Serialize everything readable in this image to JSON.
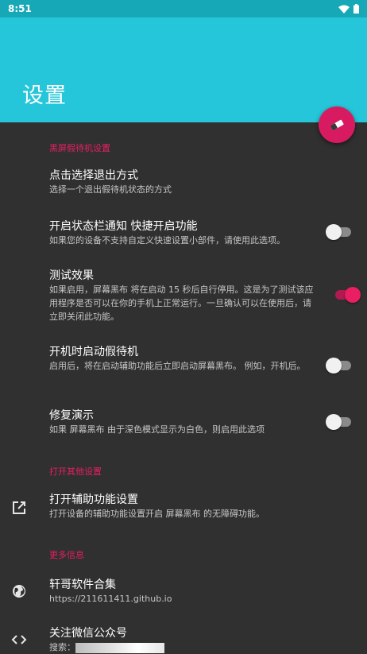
{
  "status_bar": {
    "time": "8:51",
    "wifi_icon": "wifi-icon",
    "battery_icon": "battery-icon"
  },
  "app_bar": {
    "title": "设置",
    "fab_icon": "eraser-icon"
  },
  "sections": {
    "standby": {
      "header": "黑屏假待机设置",
      "items": [
        {
          "title": "点击选择退出方式",
          "summary": "选择一个退出假待机状态的方式"
        },
        {
          "title": "开启状态栏通知 快捷开启功能",
          "summary": "如果您的设备不支持自定义快速设置小部件，请使用此选项。",
          "toggle": false
        },
        {
          "title": "测试效果",
          "summary": "如果启用，屏幕黑布 将在启动 15 秒后自行停用。这是为了测试该应用程序是否可以在你的手机上正常运行。一旦确认可以在使用后，请立即关闭此功能。",
          "toggle": true
        },
        {
          "title": "开机时启动假待机",
          "summary": "启用后，将在启动辅助功能后立即启动屏幕黑布。 例如，开机后。",
          "toggle": false
        },
        {
          "title": "修复演示",
          "summary": "如果 屏幕黑布 由于深色模式显示为白色，则启用此选项",
          "toggle": false
        }
      ]
    },
    "other": {
      "header": "打开其他设置",
      "items": [
        {
          "title": "打开辅助功能设置",
          "summary": "打开设备的辅助功能设置开启 屏幕黑布 的无障碍功能。",
          "icon": "open-external-icon"
        }
      ]
    },
    "more": {
      "header": "更多信息",
      "items": [
        {
          "title": "轩哥软件合集",
          "summary": "https://211611411.github.io",
          "icon": "globe-icon"
        },
        {
          "title": "关注微信公众号",
          "summary": "搜索：",
          "icon": "code-icon"
        }
      ]
    }
  },
  "colors": {
    "accent": "#e91e63",
    "appbar": "#26c6da",
    "statusbar": "#16a8b6",
    "background": "#303030"
  }
}
